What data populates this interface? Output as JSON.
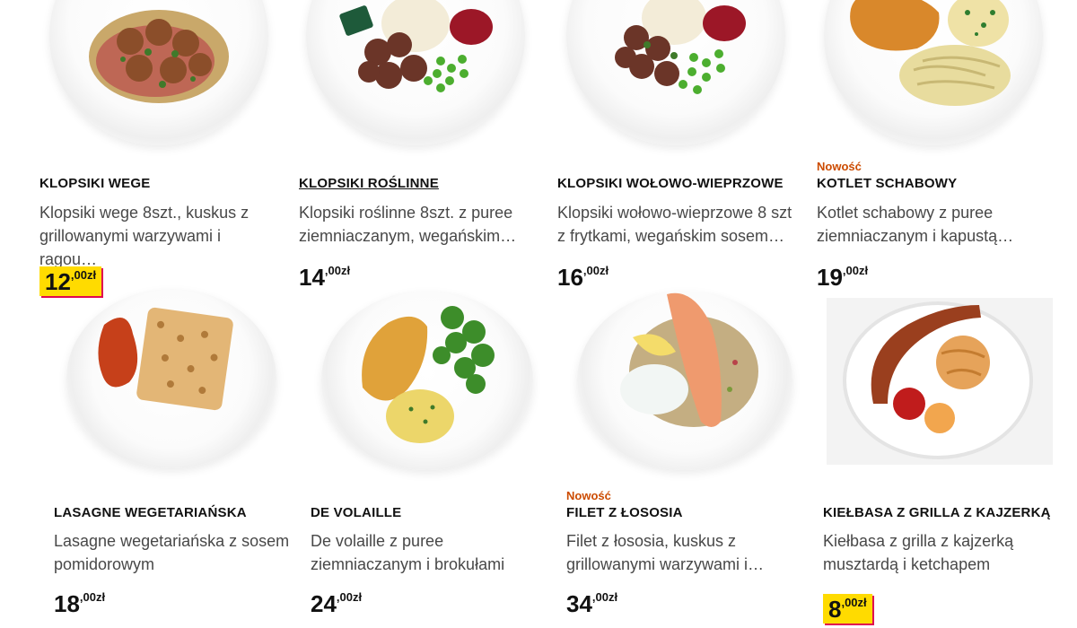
{
  "products": [
    {
      "title": "KLOPSIKI WEGE",
      "desc": "Klopsiki wege 8szt., kuskus z grillowanymi warzywami i ragou…",
      "price_int": "12",
      "price_dec": ",00zł",
      "new_label": "",
      "highlight": true,
      "image_alt": "vegetarian-meatballs-plate"
    },
    {
      "title": "KLOPSIKI ROŚLINNE",
      "desc": "Klopsiki roślinne 8szt. z puree ziemniaczanym, wegańskim…",
      "price_int": "14",
      "price_dec": ",00zł",
      "new_label": "",
      "highlight": false,
      "image_alt": "plant-meatballs-plate"
    },
    {
      "title": "KLOPSIKI WOŁOWO-WIEPRZOWE",
      "desc": "Klopsiki wołowo-wieprzowe 8 szt z frytkami, wegańskim sosem…",
      "price_int": "16",
      "price_dec": ",00zł",
      "new_label": "",
      "highlight": false,
      "image_alt": "beef-pork-meatballs-plate"
    },
    {
      "title": "KOTLET SCHABOWY",
      "desc": "Kotlet schabowy z puree ziemniaczanym i kapustą…",
      "price_int": "19",
      "price_dec": ",00zł",
      "new_label": "Nowość",
      "highlight": false,
      "image_alt": "pork-cutlet-plate"
    },
    {
      "title": "LASAGNE WEGETARIAŃSKA",
      "desc": "Lasagne wegetariańska z sosem pomidorowym",
      "price_int": "18",
      "price_dec": ",00zł",
      "new_label": "",
      "highlight": false,
      "image_alt": "lasagne-plate"
    },
    {
      "title": "DE VOLAILLE",
      "desc": "De volaille z puree ziemniaczanym i brokułami",
      "price_int": "24",
      "price_dec": ",00zł",
      "new_label": "",
      "highlight": false,
      "image_alt": "de-volaille-plate"
    },
    {
      "title": "FILET Z ŁOSOSIA",
      "desc": "Filet z łososia, kuskus z grillowanymi warzywami i…",
      "price_int": "34",
      "price_dec": ",00zł",
      "new_label": "Nowość",
      "highlight": false,
      "image_alt": "salmon-fillet-plate"
    },
    {
      "title": "KIEŁBASA Z GRILLA Z KAJZERKĄ",
      "desc": "Kiełbasa z grilla z kajzerką musztardą i ketchapem",
      "price_int": "8",
      "price_dec": ",00zł",
      "new_label": "",
      "highlight": true,
      "image_alt": "grilled-sausage-plate"
    }
  ],
  "colors": {
    "new_badge": "#cc4b00",
    "price_highlight_bg": "#ffdb00",
    "price_highlight_border": "#e00751"
  }
}
